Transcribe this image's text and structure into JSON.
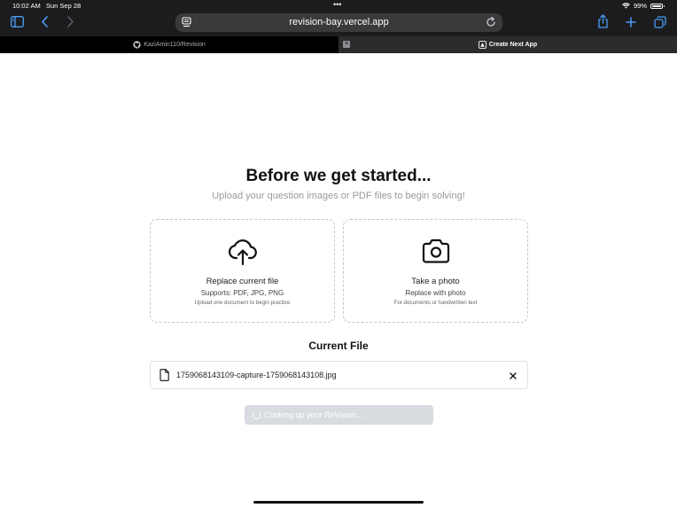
{
  "status_bar": {
    "time": "10:02 AM",
    "date": "Sun Sep 28",
    "battery": "99%",
    "battery_level": 0.99
  },
  "toolbar": {
    "url": "revision-bay.vercel.app",
    "icons": [
      "sidebar-icon",
      "back-icon",
      "forward-icon",
      "page-menu-icon",
      "reload-icon",
      "share-icon",
      "new-tab-icon",
      "tabs-overview-icon"
    ],
    "accent_color": "#4a9df8"
  },
  "tabs": [
    {
      "label": "KaziAmin110/Revision",
      "icon": "github-icon",
      "active": false
    },
    {
      "label": "Create Next App",
      "icon": "app-icon",
      "active": true
    }
  ],
  "main": {
    "heading": "Before we get started...",
    "subheading": "Upload your question images or PDF files to begin solving!",
    "upload_card": {
      "icon": "cloud-upload-icon",
      "title": "Replace current file",
      "supports": "Supports: PDF, JPG, PNG",
      "hint": "Upload one document to begin practice"
    },
    "camera_card": {
      "icon": "camera-icon",
      "title": "Take a photo",
      "subtitle": "Replace with photo",
      "hint": "For documents or handwritten text"
    },
    "current_file": {
      "title": "Current File",
      "filename": "1759068143109-capture-1759068143108.jpg"
    },
    "submit_button": {
      "label": "Cooking up your ReVision...",
      "color": "#d8dbe0"
    }
  }
}
